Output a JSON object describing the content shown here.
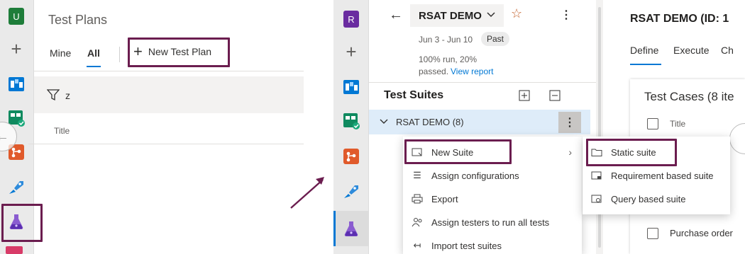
{
  "left": {
    "avatar": "U",
    "title": "Test Plans",
    "tabs": [
      {
        "label": "Mine"
      },
      {
        "label": "All"
      }
    ],
    "new_plan_label": "New Test Plan",
    "filter_value": "z",
    "column_title": "Title"
  },
  "right": {
    "avatar": "R",
    "plan_name": "RSAT DEMO",
    "dates": "Jun 3 - Jun 10",
    "past_badge": "Past",
    "stats_line1": "100% run, 20%",
    "stats_line2": "passed.",
    "view_report": "View report",
    "suites_header": "Test Suites",
    "root_suite": "RSAT DEMO (8)",
    "detail_title": "RSAT DEMO (ID: 1",
    "detail_tabs": [
      {
        "label": "Define"
      },
      {
        "label": "Execute"
      },
      {
        "label": "Ch"
      }
    ],
    "test_cases_title": "Test Cases (8 ite",
    "col_title": "Title",
    "row_label": "Purchase order",
    "context_menu": [
      {
        "label": "New Suite",
        "icon": "new-suite-icon"
      },
      {
        "label": "Assign configurations",
        "icon": "list-icon"
      },
      {
        "label": "Export",
        "icon": "printer-icon"
      },
      {
        "label": "Assign testers to run all tests",
        "icon": "people-icon"
      },
      {
        "label": "Import test suites",
        "icon": "import-icon"
      }
    ],
    "submenu": [
      {
        "label": "Static suite",
        "icon": "folder-icon"
      },
      {
        "label": "Requirement based suite",
        "icon": "requirement-suite-icon"
      },
      {
        "label": "Query based suite",
        "icon": "query-suite-icon"
      }
    ]
  },
  "colors": {
    "accent": "#0078d4",
    "highlight": "#6b1d4f",
    "selected_row": "#deecf9"
  }
}
